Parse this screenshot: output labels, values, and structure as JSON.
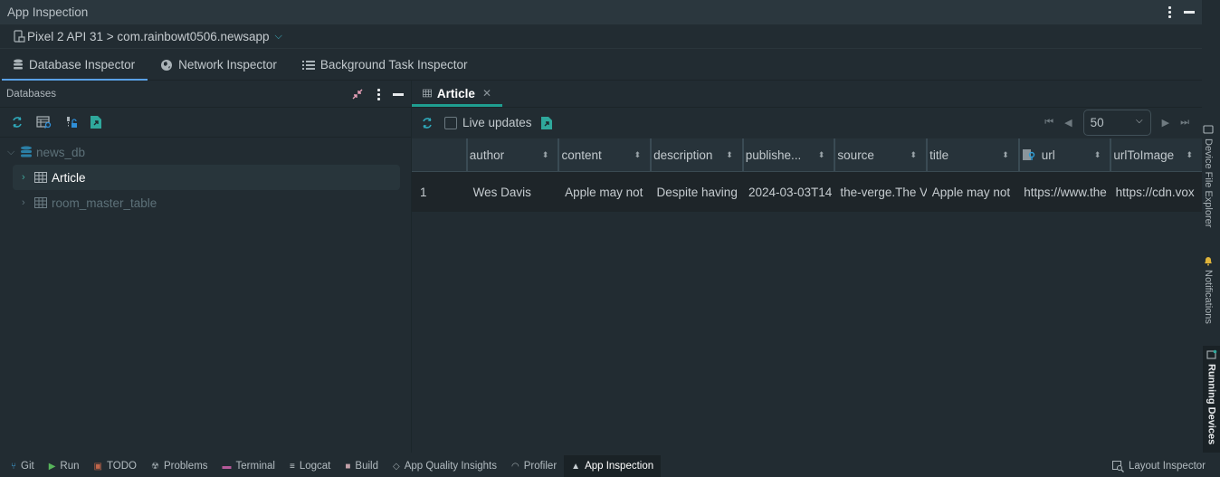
{
  "window": {
    "title": "App Inspection"
  },
  "device": {
    "label": "Pixel 2 API 31 > com.rainbowt0506.newsapp"
  },
  "tabs": [
    {
      "label": "Database Inspector",
      "icon": "database-icon",
      "active": true
    },
    {
      "label": "Network Inspector",
      "icon": "globe-icon",
      "active": false
    },
    {
      "label": "Background Task Inspector",
      "icon": "list-icon",
      "active": false
    }
  ],
  "databases_panel": {
    "title": "Databases",
    "tree": {
      "database": "news_db",
      "tables": [
        {
          "name": "Article",
          "selected": true
        },
        {
          "name": "room_master_table",
          "selected": false
        }
      ]
    }
  },
  "table_view": {
    "tab_label": "Article",
    "live_updates_label": "Live updates",
    "live_updates_checked": false,
    "page_size": "50",
    "columns": [
      "author",
      "content",
      "description",
      "publishe...",
      "source",
      "title",
      "url",
      "urlToImage"
    ],
    "primary_key_column": "url",
    "rows": [
      {
        "index": "1",
        "cells": [
          "Wes Davis",
          "Apple may not",
          "Despite having",
          "2024-03-03T14",
          "the-verge.The V",
          "Apple may not",
          "https://www.the",
          "https://cdn.vox"
        ]
      }
    ]
  },
  "side_tools": [
    {
      "label": "Device File Explorer",
      "active": false
    },
    {
      "label": "Notifications",
      "active": false
    },
    {
      "label": "Running Devices",
      "active": true
    }
  ],
  "status_bar": {
    "items": [
      {
        "label": "Git",
        "icon": "git-branch-icon",
        "color": "#3fa0d8"
      },
      {
        "label": "Run",
        "icon": "run-icon",
        "color": "#57b55b"
      },
      {
        "label": "TODO",
        "icon": "todo-icon",
        "color": "#c0654a"
      },
      {
        "label": "Problems",
        "icon": "problems-icon",
        "color": "#9aa4a9"
      },
      {
        "label": "Terminal",
        "icon": "terminal-icon",
        "color": "#b65a9a"
      },
      {
        "label": "Logcat",
        "icon": "logcat-icon",
        "color": "#c8cfd3"
      },
      {
        "label": "Build",
        "icon": "build-icon",
        "color": "#c2a0a8"
      },
      {
        "label": "App Quality Insights",
        "icon": "diamond-icon",
        "color": "#9aa4a9"
      },
      {
        "label": "Profiler",
        "icon": "gauge-icon",
        "color": "#9aa4a9"
      },
      {
        "label": "App Inspection",
        "icon": "inspector-icon",
        "color": "#c8cfd3",
        "active": true
      }
    ],
    "right_item": {
      "label": "Layout Inspector",
      "icon": "layout-inspector-icon"
    }
  }
}
